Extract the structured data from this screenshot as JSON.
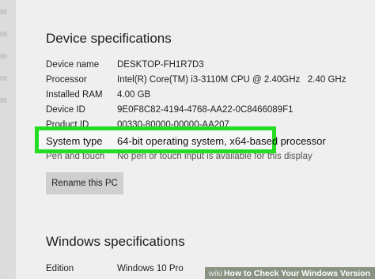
{
  "device_specs": {
    "title": "Device specifications",
    "rows": [
      {
        "label": "Device name",
        "value": "DESKTOP-FH1R7D3"
      },
      {
        "label": "Processor",
        "value": "Intel(R) Core(TM) i3-3110M CPU @ 2.40GHz   2.40 GHz"
      },
      {
        "label": "Installed RAM",
        "value": "4.00 GB"
      },
      {
        "label": "Device ID",
        "value": "9E0F8C82-4194-4768-AA22-0C8466089F1"
      },
      {
        "label": "Product ID",
        "value": "00330-80000-00000-AA207"
      }
    ],
    "highlight": {
      "label": "System type",
      "value": "64-bit operating system, x64-based processor"
    },
    "pen_touch": {
      "label": "Pen and touch",
      "value": "No pen or touch input is available for this display"
    },
    "rename_button": "Rename this PC"
  },
  "windows_specs": {
    "title": "Windows specifications",
    "rows": [
      {
        "label": "Edition",
        "value": "Windows 10 Pro"
      }
    ]
  },
  "watermark": {
    "brand": "wiki",
    "text": "How to Check Your Windows Version"
  },
  "colors": {
    "highlight": "#22dd22",
    "background": "#efefef"
  }
}
